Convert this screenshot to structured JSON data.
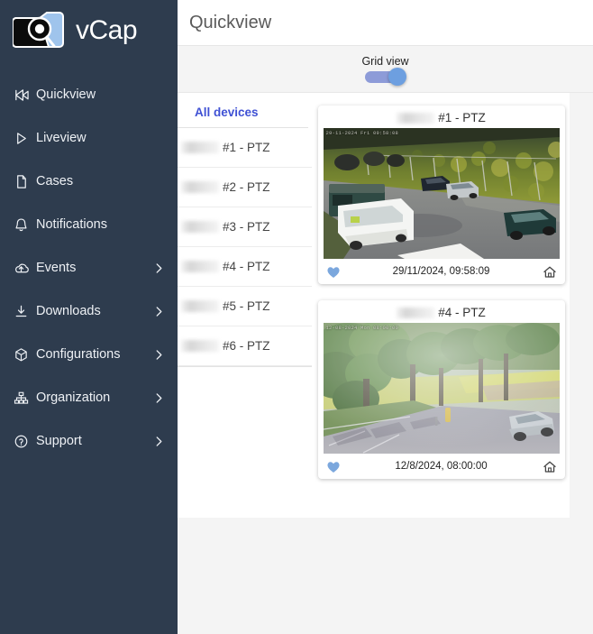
{
  "brand": {
    "name": "vCap",
    "logo_icon": "camera-folder-logo"
  },
  "sidebar": {
    "items": [
      {
        "label": "Quickview",
        "icon": "fast-forward-icon",
        "chevron": false
      },
      {
        "label": "Liveview",
        "icon": "play-icon",
        "chevron": false
      },
      {
        "label": "Cases",
        "icon": "document-icon",
        "chevron": false
      },
      {
        "label": "Notifications",
        "icon": "bell-icon",
        "chevron": false
      },
      {
        "label": "Events",
        "icon": "events-cloud-icon",
        "chevron": true
      },
      {
        "label": "Downloads",
        "icon": "download-icon",
        "chevron": true
      },
      {
        "label": "Configurations",
        "icon": "cube-icon",
        "chevron": true
      },
      {
        "label": "Organization",
        "icon": "org-tree-icon",
        "chevron": true
      },
      {
        "label": "Support",
        "icon": "question-circle-icon",
        "chevron": true
      }
    ]
  },
  "header": {
    "title": "Quickview"
  },
  "toolbar": {
    "grid_view_label": "Grid view",
    "grid_view_on": true
  },
  "device_panel": {
    "tab_label": "All devices",
    "devices": [
      {
        "redacted": true,
        "name": "#1 - PTZ"
      },
      {
        "redacted": true,
        "name": "#2 - PTZ"
      },
      {
        "redacted": true,
        "name": "#3 - PTZ"
      },
      {
        "redacted": true,
        "name": "#4 - PTZ"
      },
      {
        "redacted": true,
        "name": "#5 - PTZ"
      },
      {
        "redacted": true,
        "name": "#6 - PTZ"
      }
    ]
  },
  "cards": [
    {
      "title": "#1 - PTZ",
      "redacted_prefix": true,
      "overlay_timestamp": "29-11-2024 Fri 09:58:08",
      "timestamp": "29/11/2024, 09:58:09",
      "favorite": true,
      "favorite_icon": "heart-icon",
      "home_icon": "home-icon",
      "scene": "road-autumn"
    },
    {
      "title": "#4 - PTZ",
      "redacted_prefix": true,
      "overlay_timestamp": "12-08-2024 Mon 08:00:00",
      "timestamp": "12/8/2024, 08:00:00",
      "favorite": true,
      "favorite_icon": "heart-icon",
      "home_icon": "home-icon",
      "scene": "park-summer"
    }
  ],
  "colors": {
    "sidebar_bg": "#2e3c4e",
    "accent_link": "#3f51d4",
    "toggle_track": "#8d9bd8",
    "toggle_knob": "#6d9fe0",
    "heart": "#7ba7dd",
    "page_bg": "#f4f4f4"
  }
}
